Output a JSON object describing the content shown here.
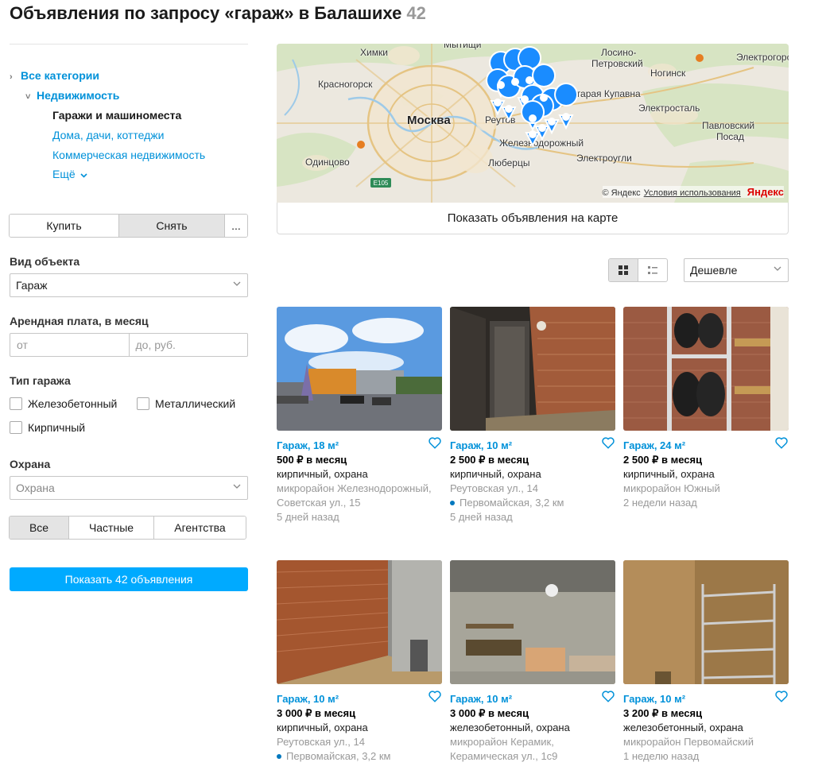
{
  "header": {
    "title": "Объявления по запросу «гараж» в Балашихе",
    "count": "42"
  },
  "categories": {
    "all": "Все категории",
    "realty": "Недвижимость",
    "current": "Гаражи и машиноместа",
    "items": [
      "Дома, дачи, коттеджи",
      "Коммерческая недвижимость"
    ],
    "more": "Ещё"
  },
  "deal_type": {
    "buy": "Купить",
    "rent": "Снять",
    "more": "..."
  },
  "filters": {
    "object_label": "Вид объекта",
    "object_value": "Гараж",
    "price_label": "Арендная плата, в месяц",
    "price_from": "от",
    "price_to": "до, руб.",
    "garage_type_label": "Тип гаража",
    "garage_types": [
      "Железобетонный",
      "Металлический",
      "Кирпичный"
    ],
    "security_label": "Охрана",
    "security_placeholder": "Охрана",
    "sellers": [
      "Все",
      "Частные",
      "Агентства"
    ],
    "submit": "Показать 42 объявления"
  },
  "map": {
    "labels": {
      "khimki": "Химки",
      "mytishchi": "Мытищи",
      "losino": "Лосино-",
      "petrovsky": "Петровский",
      "elektrogorsk": "Электрогорс",
      "krasnogorsk": "Красногорск",
      "noginsk": "Ногинск",
      "kupavna": "Старая Купавна",
      "moskva": "Москва",
      "reutov": "Реутов",
      "elektrostal": "Электросталь",
      "pavlovsky": "Павловский",
      "posad": "Посад",
      "zheleznodorozhny": "Железнодорожный",
      "odintsovo": "Одинцово",
      "lyubertsy": "Люберцы",
      "elektrougli": "Электроугли",
      "e105": "E105"
    },
    "copyright": "© Яндекс",
    "terms": "Условия использования",
    "logo": "Яндекс",
    "show_button": "Показать объявления на карте"
  },
  "sort": {
    "value": "Дешевле"
  },
  "listings": [
    {
      "title": "Гараж, 18 м²",
      "price": "500 ₽ в месяц",
      "params": "кирпичный, охрана",
      "address": "микрорайон Железнодорожный, Советская ул., 15",
      "metro": "",
      "date": "5 дней назад"
    },
    {
      "title": "Гараж, 10 м²",
      "price": "2 500 ₽ в месяц",
      "params": "кирпичный, охрана",
      "address": "Реутовская ул., 14",
      "metro": "Первомайская, 3,2 км",
      "date": "5 дней назад"
    },
    {
      "title": "Гараж, 24 м²",
      "price": "2 500 ₽ в месяц",
      "params": "кирпичный, охрана",
      "address": "микрорайон Южный",
      "metro": "",
      "date": "2 недели назад"
    },
    {
      "title": "Гараж, 10 м²",
      "price": "3 000 ₽ в месяц",
      "params": "кирпичный, охрана",
      "address": "Реутовская ул., 14",
      "metro": "Первомайская, 3,2 км",
      "date": ""
    },
    {
      "title": "Гараж, 10 м²",
      "price": "3 000 ₽ в месяц",
      "params": "железобетонный, охрана",
      "address": "микрорайон Керамик, Керамическая ул., 1с9",
      "metro": "",
      "date": ""
    },
    {
      "title": "Гараж, 10 м²",
      "price": "3 200 ₽ в месяц",
      "params": "железобетонный, охрана",
      "address": "микрорайон Первомайский",
      "metro": "",
      "date": "1 неделю назад"
    }
  ]
}
